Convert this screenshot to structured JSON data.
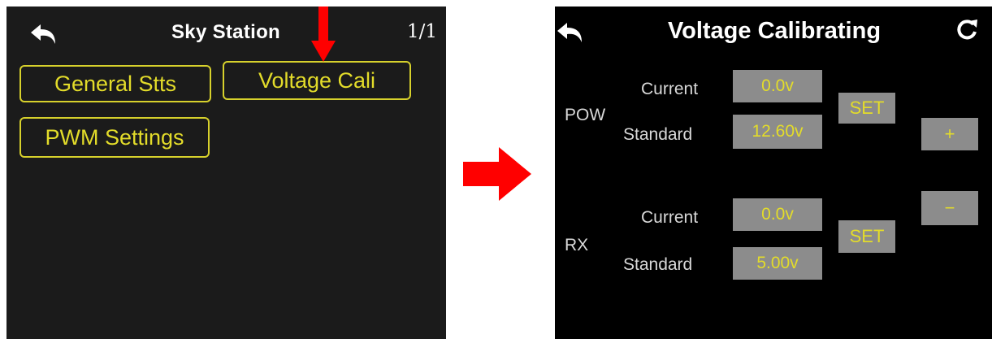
{
  "left_screen": {
    "title": "Sky Station",
    "page_indicator": "1/1",
    "buttons": {
      "general": "General Stts",
      "voltage": "Voltage Cali",
      "pwm": "PWM Settings"
    }
  },
  "right_screen": {
    "title": "Voltage Calibrating",
    "pow": {
      "label": "POW",
      "current_label": "Current",
      "current_value": "0.0v",
      "standard_label": "Standard",
      "standard_value": "12.60v",
      "set_label": "SET"
    },
    "rx": {
      "label": "RX",
      "current_label": "Current",
      "current_value": "0.0v",
      "standard_label": "Standard",
      "standard_value": "5.00v",
      "set_label": "SET"
    },
    "plus_label": "+",
    "minus_label": "−"
  },
  "colors": {
    "accent_yellow": "#e3dc2a",
    "arrow_red": "#ff0000",
    "box_gray": "#8c8c8c"
  },
  "icons": [
    "back-arrow-icon",
    "refresh-icon",
    "red-arrow-down-icon",
    "red-arrow-right-icon"
  ]
}
